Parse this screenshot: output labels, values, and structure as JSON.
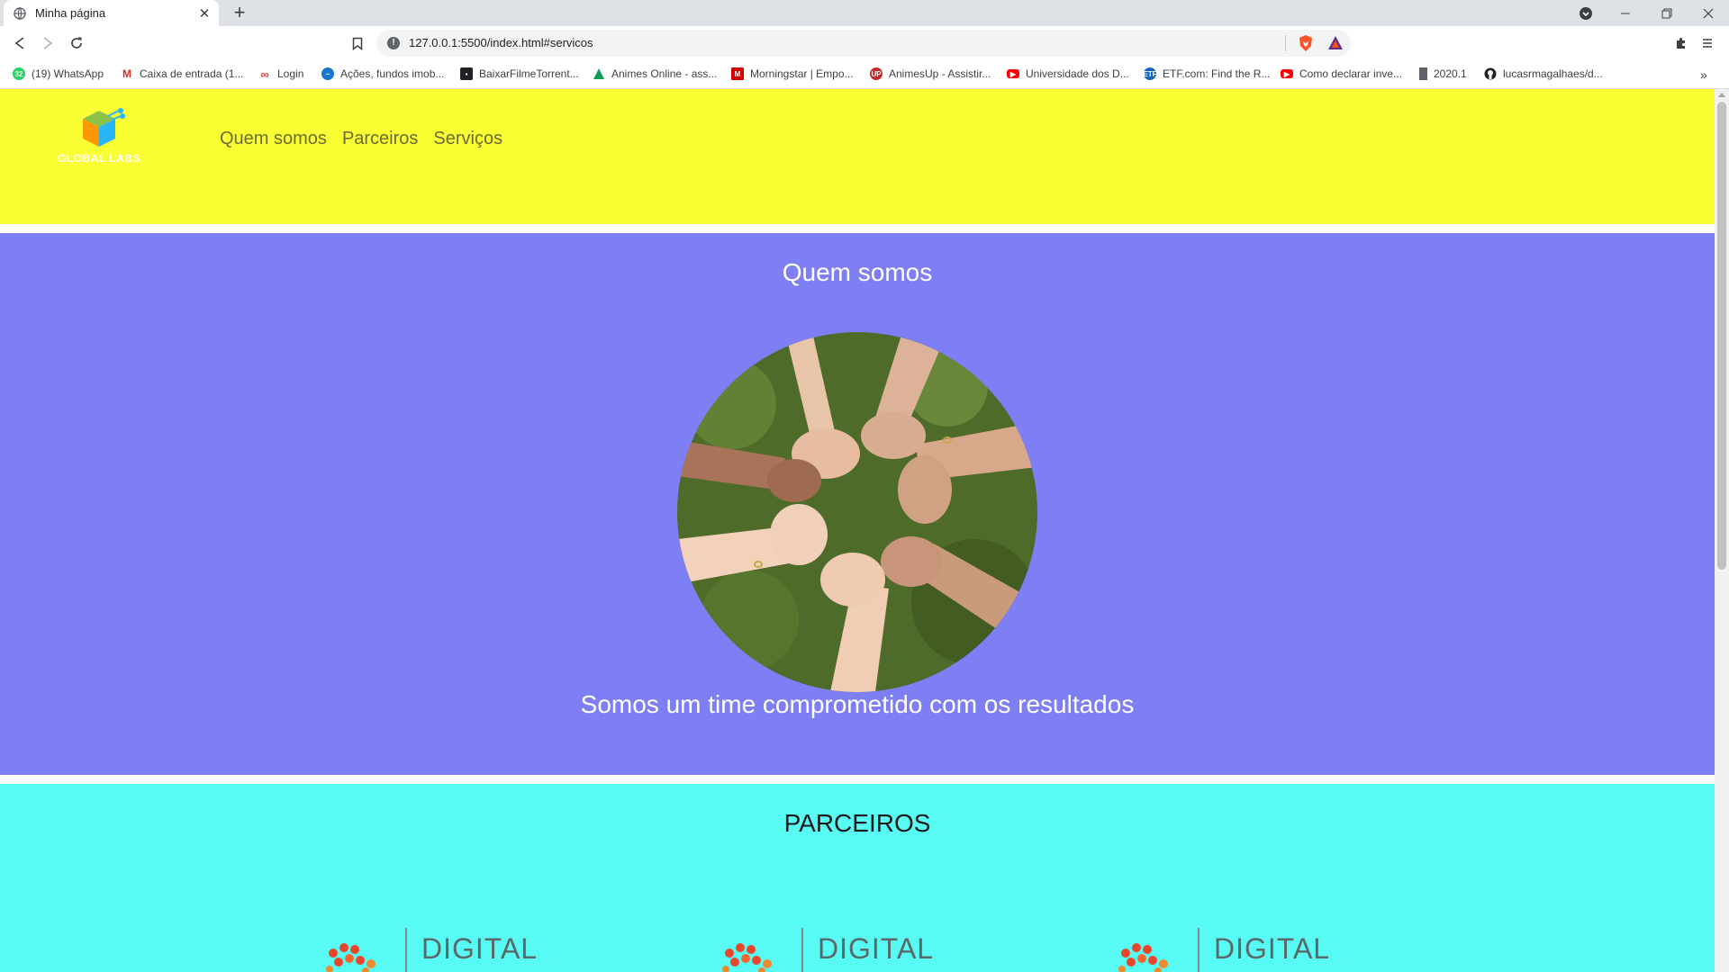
{
  "browser": {
    "tab_title": "Minha página",
    "url": "127.0.0.1:5500/index.html#servicos",
    "bookmarks": [
      {
        "label": "(19) WhatsApp",
        "icon": "whatsapp-icon",
        "color": "#25d366"
      },
      {
        "label": "Caixa de entrada (1...",
        "icon": "gmail-icon",
        "color": "#d93025"
      },
      {
        "label": "Login",
        "icon": "infinity-icon",
        "color": "#e53935"
      },
      {
        "label": "Ações, fundos imob...",
        "icon": "chart-icon",
        "color": "#1976d2"
      },
      {
        "label": "BaixarFilmeTorrent...",
        "icon": "film-icon",
        "color": "#202124"
      },
      {
        "label": "Animes Online - ass...",
        "icon": "triangle-icon",
        "color": "#0f9d58"
      },
      {
        "label": "Morningstar | Empo...",
        "icon": "morningstar-icon",
        "color": "#d50000"
      },
      {
        "label": "AnimesUp - Assistir...",
        "icon": "animesup-icon",
        "color": "#c62828"
      },
      {
        "label": "Universidade dos D...",
        "icon": "youtube-icon",
        "color": "#ff0000"
      },
      {
        "label": "ETF.com: Find the R...",
        "icon": "etf-icon",
        "color": "#1565c0"
      },
      {
        "label": "Como declarar inve...",
        "icon": "youtube-icon",
        "color": "#ff0000"
      },
      {
        "label": "2020.1",
        "icon": "document-icon",
        "color": "#5f6368"
      },
      {
        "label": "lucasrmagalhaes/d...",
        "icon": "github-icon",
        "color": "#202124"
      }
    ]
  },
  "site": {
    "logo_text": "GLOBAL LABS",
    "nav": [
      "Quem somos",
      "Parceiros",
      "Serviços"
    ],
    "about": {
      "title": "Quem somos",
      "text": "Somos um time comprometido com os resultados"
    },
    "partners": {
      "title": "PARCEIROS",
      "logos": [
        "DIGITAL",
        "DIGITAL",
        "DIGITAL"
      ]
    }
  },
  "colors": {
    "header_bg": "#faff33",
    "about_bg": "#7f7ff5",
    "partners_bg": "#58fbf3",
    "nav_text": "#6b6b33"
  }
}
